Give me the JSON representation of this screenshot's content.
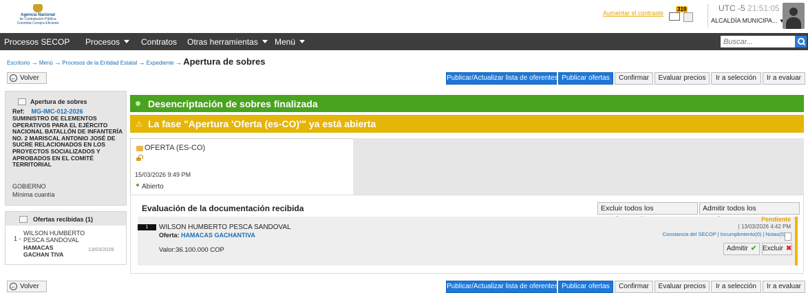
{
  "logo": {
    "line1": "Agencia Nacional",
    "line2": "de Contratación Pública",
    "line3": "Colombia Compra Eficiente"
  },
  "header": {
    "contrast_link": "Aumentar el contraste",
    "notification_count": "319",
    "timezone": "UTC -5",
    "time": "21:51:05",
    "organization": "ALCALDÍA MUNICIPA..."
  },
  "nav": {
    "items": [
      "Procesos SECOP",
      "Procesos",
      "Contratos",
      "Otras herramientas",
      "Menú"
    ],
    "search_placeholder": "Buscar..."
  },
  "breadcrumb": {
    "items": [
      "Escritorio",
      "Menú",
      "Procesos de la Entidad Estatal",
      "Expediente"
    ],
    "current": "Apertura de sobres"
  },
  "actions": {
    "back": "Volver",
    "publish_list": "Publicar/Actualizar lista de oferentes",
    "publish_offers": "Publicar ofertas",
    "confirm": "Confirmar",
    "evaluate_prices": "Evaluar precios",
    "go_selection": "Ir a selección",
    "go_evaluate": "Ir a evaluar"
  },
  "process": {
    "title": "Apertura de sobres",
    "ref_label": "Ref:",
    "ref_code": "MG-IMC-012-2026",
    "description": "SUMINISTRO DE ELEMENTOS OPERATIVOS PARA EL EJÉRCITO NACIONAL BATALLÓN DE INFANTERÍA NO. 2 MARISCAL ANTONIO JOSÉ DE SUCRE RELACIONADOS EN LOS PROYECTOS SOCIALIZADOS Y APROBADOS EN EL COMITÉ TERRITORIAL",
    "sector": "GOBIERNO",
    "modality": "Mínima cuantía"
  },
  "offers_panel": {
    "title": "Ofertas recibidas (1)",
    "index": "1 -",
    "bidder": "WILSON HUMBERTO PESCA SANDOVAL",
    "offer_name": "HAMACAS GACHAN TIVA",
    "date": "13/03/2026"
  },
  "alerts": {
    "success": "Desencriptación de sobres finalizada",
    "warning": "La fase \"Apertura 'Oferta (es-CO)'\" ya está abierta"
  },
  "phase": {
    "title": "OFERTA (ES-CO)",
    "date": "15/03/2026 9:49 PM",
    "state": "Abierto"
  },
  "evaluation": {
    "title": "Evaluación de la documentación recibida",
    "exclude_all": "Excluir todos los pendientes",
    "admit_all": "Admitir todos los pendientes",
    "offer": {
      "number": "1",
      "bidder": "WILSON HUMBERTO PESCA SANDOVAL",
      "offer_label": "Oferta:",
      "offer_name": "HAMACAS GACHANTIVA",
      "value": "Valor:36.100.000 COP",
      "status": "Pendiente",
      "date": "| 13/03/2026 4:42 PM",
      "link_constancia": "Constancia del SECOP",
      "link_incumplimiento": "Incumplimiento(0)",
      "link_notas": "Notas(0)",
      "admit": "Admitir",
      "exclude": "Excluir"
    }
  },
  "colors": {
    "nav_bg": "#3d3d3d",
    "primary_button": "#1d78d8",
    "success_bar": "#4aa31e",
    "warning_bar": "#e5b50a",
    "pending": "#e0a500",
    "link": "#1a6fb5"
  }
}
